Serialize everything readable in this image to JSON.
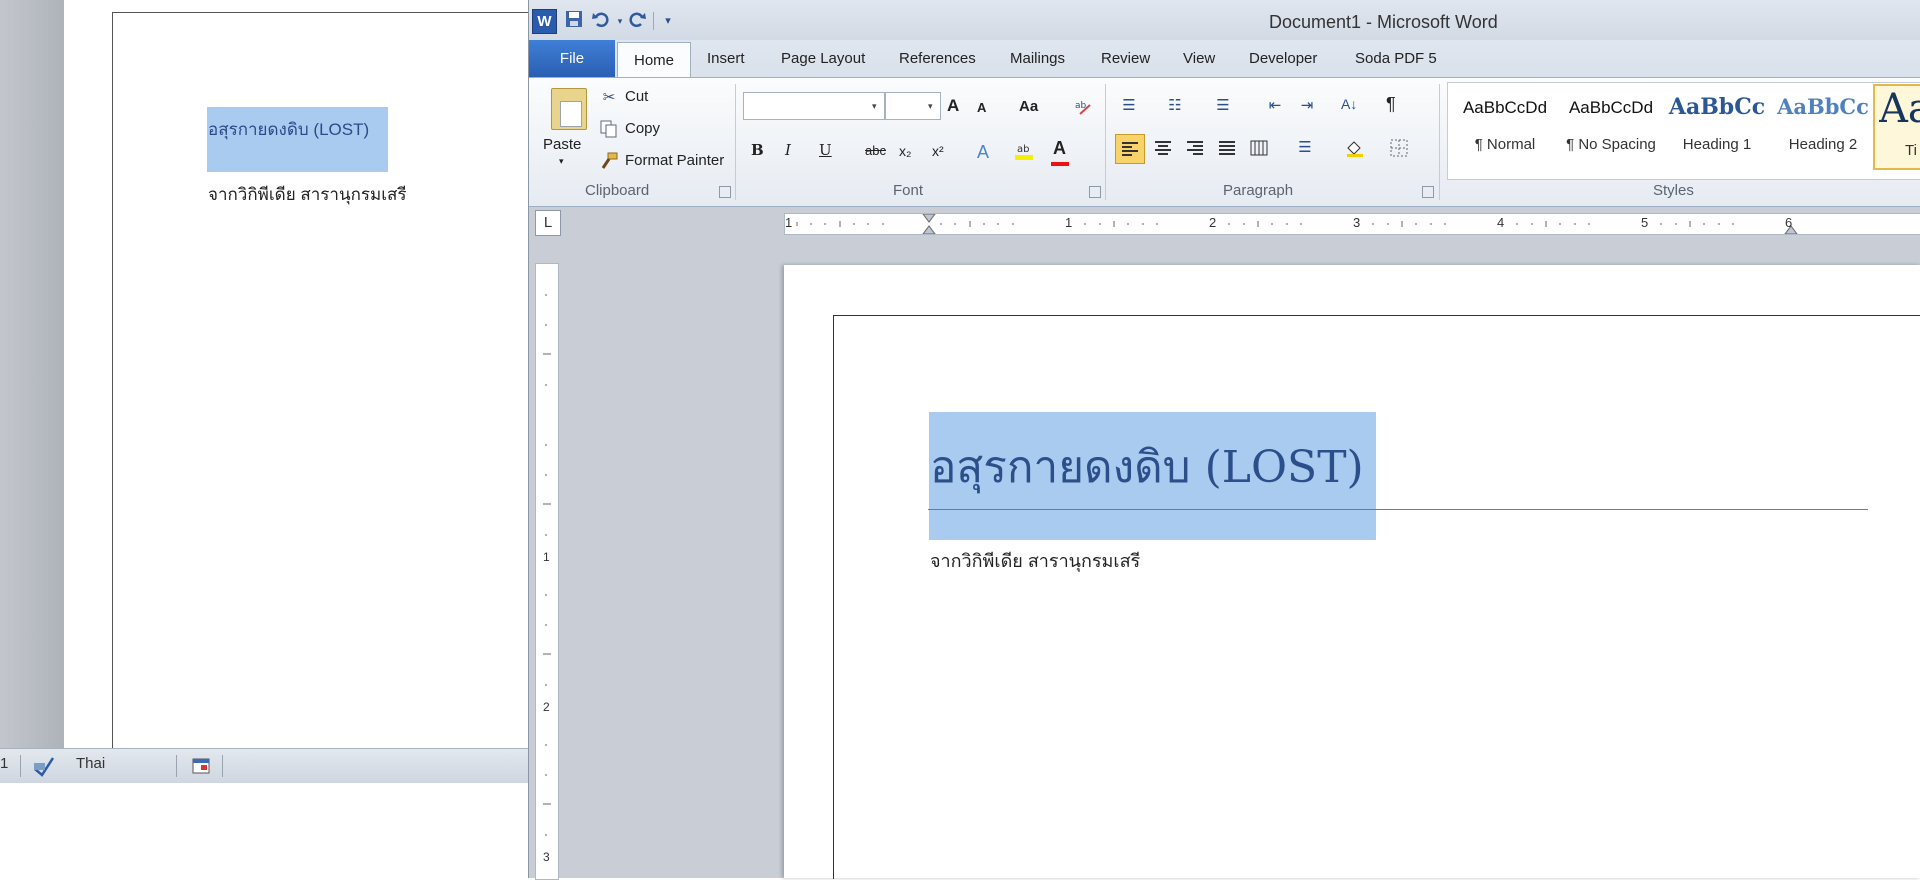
{
  "background_window": {
    "doc_title": "อสุรกายดงดิบ (LOST)",
    "doc_subtitle": "จากวิกิพีเดีย สารานุกรมเสรี",
    "status_page_fragment": "1",
    "status_language": "Thai"
  },
  "app": {
    "title": "Document1  -  Microsoft Word",
    "logo_letter": "W"
  },
  "quick_access": {
    "save_icon": "save-icon",
    "undo_icon": "undo-icon",
    "redo_icon": "redo-icon",
    "customize_icon": "customize-icon"
  },
  "tabs": {
    "file": "File",
    "home": "Home",
    "insert": "Insert",
    "page_layout": "Page Layout",
    "references": "References",
    "mailings": "Mailings",
    "review": "Review",
    "view": "View",
    "developer": "Developer",
    "soda_pdf": "Soda PDF 5"
  },
  "clipboard": {
    "paste": "Paste",
    "cut": "Cut",
    "copy": "Copy",
    "format_painter": "Format Painter",
    "label": "Clipboard"
  },
  "font": {
    "font_name": "",
    "font_size": "",
    "grow": "A",
    "shrink": "A",
    "change_case": "Aa",
    "bold": "B",
    "italic": "I",
    "underline": "U",
    "strikethrough": "abc",
    "subscript": "x₂",
    "superscript": "x²",
    "font_color": "A",
    "label": "Font"
  },
  "paragraph": {
    "show_marks": "¶",
    "sort": "A↓",
    "label": "Paragraph"
  },
  "styles": {
    "label": "Styles",
    "items": [
      {
        "sample": "AaBbCcDd",
        "name": "¶ Normal"
      },
      {
        "sample": "AaBbCcDd",
        "name": "¶ No Spacing"
      },
      {
        "sample": "AaBbCc",
        "name": "Heading 1"
      },
      {
        "sample": "AaBbCc",
        "name": "Heading 2"
      },
      {
        "sample": "Aa",
        "name": "Ti"
      }
    ]
  },
  "ruler": {
    "tab_selector": "L",
    "h_numbers": [
      "1",
      "1",
      "2",
      "3",
      "4",
      "5",
      "6"
    ],
    "v_numbers": [
      "1",
      "2",
      "3"
    ]
  },
  "document": {
    "heading": "อสุรกายดงดิบ (LOST)",
    "subtitle": "จากวิกิพีเดีย สารานุกรมเสรี"
  },
  "colors": {
    "selection": "#a9cbef",
    "file_tab": "#2a5fb3",
    "heading_text": "#2b4f8a",
    "heading_rule": "#4f81bd"
  }
}
